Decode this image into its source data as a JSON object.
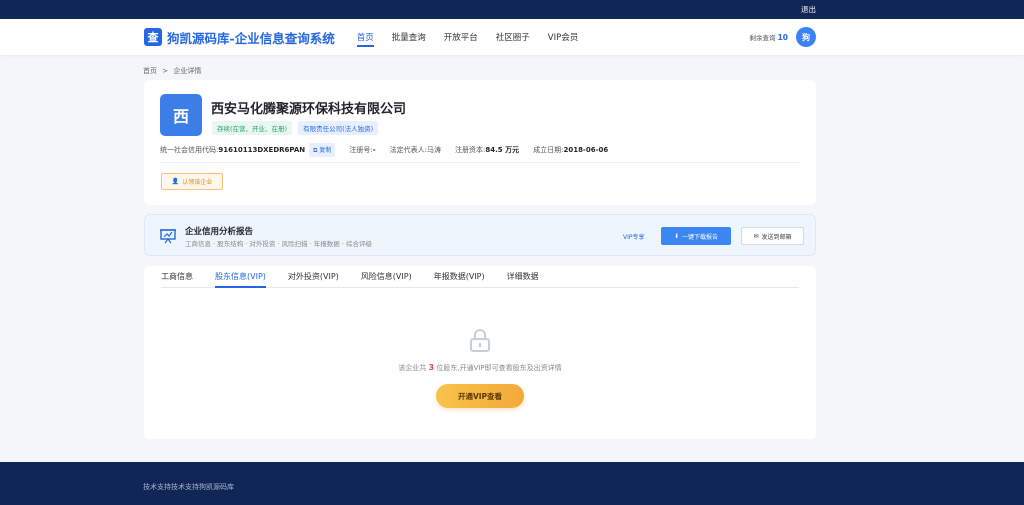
{
  "topbar": {
    "logout": "退出"
  },
  "header": {
    "logo_char": "查",
    "brand": "狗凯源码库-企业信息查询系统",
    "nav": [
      "首页",
      "批量查询",
      "开放平台",
      "社区圈子",
      "VIP会员"
    ],
    "quota_label": "剩余查询",
    "quota_value": "10",
    "avatar_char": "狗"
  },
  "breadcrumb": {
    "home": "首页",
    "separator": ">",
    "current": "企业详情"
  },
  "company": {
    "logo_char": "西",
    "name": "西安马化腾聚源环保科技有限公司",
    "tags": [
      "存续(在营、开业、在册)",
      "有限责任公司(法人独资)"
    ],
    "credit_code_label": "统一社会信用代码:",
    "credit_code": "91610113DXEDR6PAN",
    "copy_label": "复制",
    "reg_no_label": "注册号:",
    "reg_no": "-",
    "legal_rep_label": "法定代表人:",
    "legal_rep": "马涛",
    "capital_label": "注册资本:",
    "capital": "84.5 万元",
    "founded_label": "成立日期:",
    "founded": "2018-06-06",
    "claim_label": "认领该企业"
  },
  "report": {
    "title": "企业信用分析报告",
    "subtitle": "工商信息 · 股东结构 · 对外投资 · 风险扫描 · 年报数据 · 综合评级",
    "vip_badge": "VIP专享",
    "download_label": "一键下载报告",
    "email_label": "发送到邮箱"
  },
  "tabs": [
    "工商信息",
    "股东信息(VIP)",
    "对外投资(VIP)",
    "风险信息(VIP)",
    "年报数据(VIP)",
    "详细数据"
  ],
  "locked": {
    "text_prefix": "该企业共",
    "count": "3",
    "text_suffix": "位股东,开通VIP即可查看股东及出资详情",
    "button": "开通VIP查看"
  },
  "footer": {
    "text": "技术支持技术支持狗凯源码库"
  }
}
